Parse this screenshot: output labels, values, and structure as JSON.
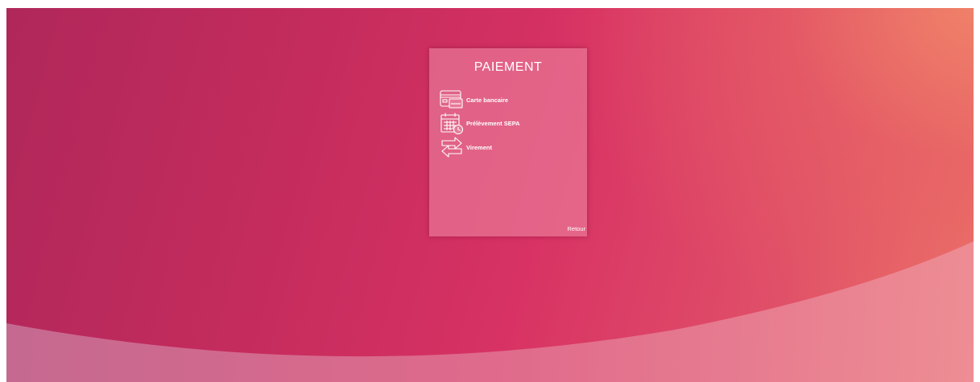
{
  "colors": {
    "background_start": "#b0275a",
    "background_end": "#ec7468",
    "card_background": "#e88aa5",
    "text": "#ffffff"
  },
  "payment_card": {
    "title": "PAIEMENT",
    "options": [
      {
        "label": "Carte bancaire",
        "icon": "credit-card-icon"
      },
      {
        "label": "Prélèvement SEPA",
        "icon": "calendar-clock-icon"
      },
      {
        "label": "Virement",
        "icon": "transfer-arrows-icon"
      }
    ],
    "back_label": "Retour"
  }
}
